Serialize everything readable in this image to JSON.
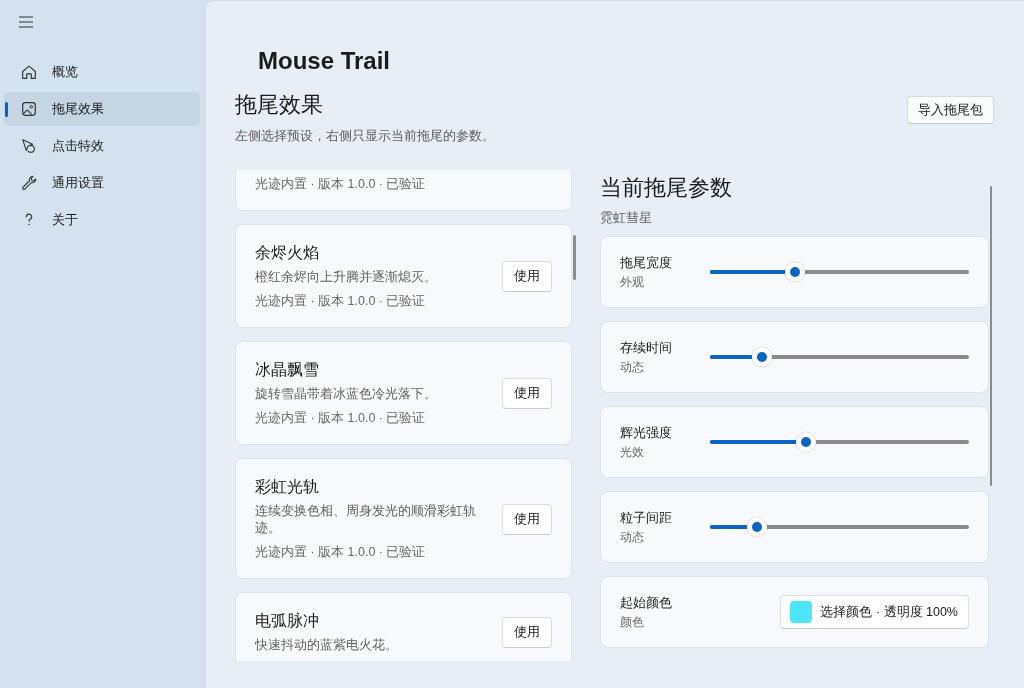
{
  "app": {
    "title": "Mouse Trail"
  },
  "sidebar": {
    "items": [
      {
        "label": "概览",
        "selected": false
      },
      {
        "label": "拖尾效果",
        "selected": true
      },
      {
        "label": "点击特效",
        "selected": false
      },
      {
        "label": "通用设置",
        "selected": false
      },
      {
        "label": "关于",
        "selected": false
      }
    ]
  },
  "page": {
    "heading": "拖尾效果",
    "description": "左侧选择预设，右侧只显示当前拖尾的参数。",
    "import_button": "导入拖尾包"
  },
  "presets": [
    {
      "meta": "光迹内置 · 版本 1.0.0 · 已验证"
    },
    {
      "name": "余烬火焰",
      "description": "橙红余烬向上升腾并逐渐熄灭。",
      "meta": "光迹内置 · 版本 1.0.0 · 已验证",
      "button": "使用"
    },
    {
      "name": "冰晶飘雪",
      "description": "旋转雪晶带着冰蓝色冷光落下。",
      "meta": "光迹内置 · 版本 1.0.0 · 已验证",
      "button": "使用"
    },
    {
      "name": "彩虹光轨",
      "description": "连续变换色相、周身发光的顺滑彩虹轨迹。",
      "meta": "光迹内置 · 版本 1.0.0 · 已验证",
      "button": "使用"
    },
    {
      "name": "电弧脉冲",
      "description": "快速抖动的蓝紫电火花。",
      "button": "使用"
    }
  ],
  "params": {
    "heading": "当前拖尾参数",
    "subheading": "霓虹彗星",
    "items": [
      {
        "kind": "slider",
        "label": "拖尾宽度",
        "category": "外观",
        "level": 0.33
      },
      {
        "kind": "slider",
        "label": "存续时间",
        "category": "动态",
        "level": 0.2
      },
      {
        "kind": "slider",
        "label": "辉光强度",
        "category": "光效",
        "level": 0.37
      },
      {
        "kind": "slider",
        "label": "粒子间距",
        "category": "动态",
        "level": 0.18
      },
      {
        "kind": "color",
        "label": "起始颜色",
        "category": "颜色",
        "color": "#4de5f8",
        "button": "选择颜色 · 透明度 100%"
      }
    ]
  }
}
